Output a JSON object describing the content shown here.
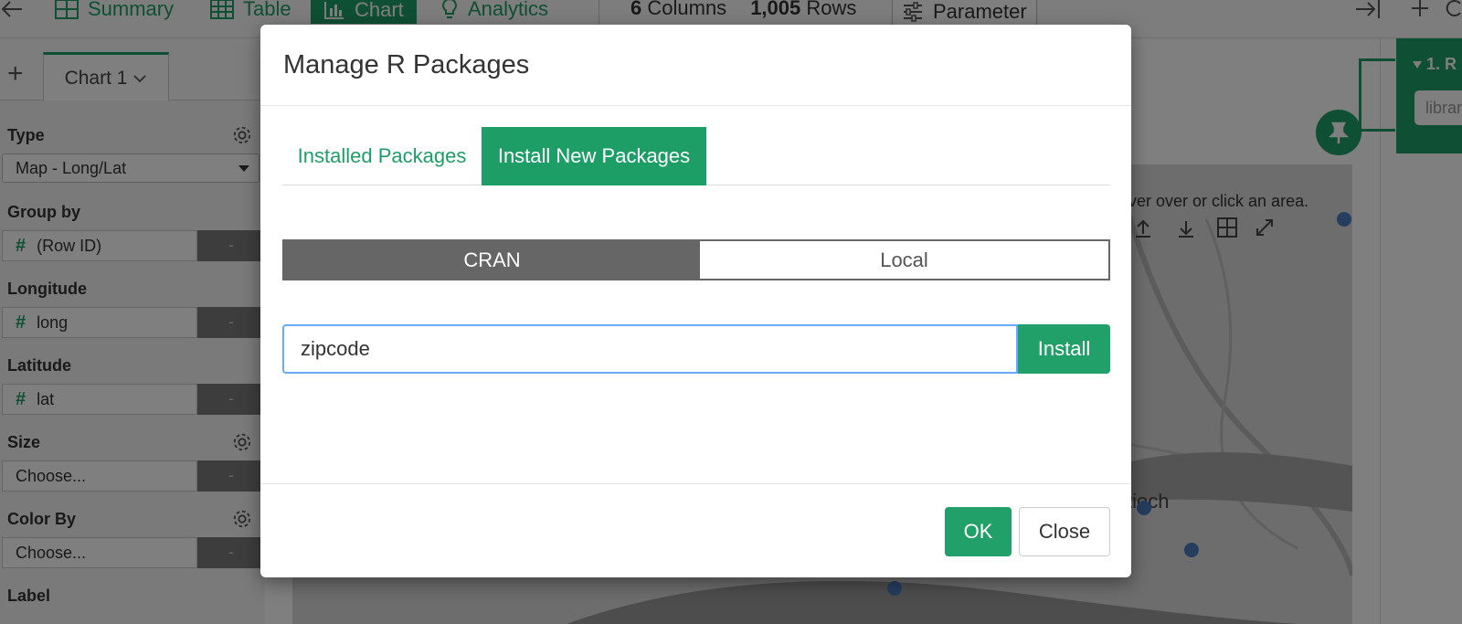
{
  "topbar": {
    "nav": [
      {
        "label": "Summary",
        "icon": "summary-grid-icon"
      },
      {
        "label": "Table",
        "icon": "table-icon"
      },
      {
        "label": "Chart",
        "icon": "bar-chart-icon",
        "active": true
      },
      {
        "label": "Analytics",
        "icon": "lightbulb-icon"
      }
    ],
    "columns_count": "6",
    "columns_label": "Columns",
    "rows_count": "1,005",
    "rows_label": "Rows",
    "parameter_label": "Parameter"
  },
  "chart_tabs": {
    "add_label": "+",
    "current": "Chart 1"
  },
  "config": {
    "type_label": "Type",
    "type_value": "Map - Long/Lat",
    "group_by_label": "Group by",
    "group_by_value": "(Row ID)",
    "longitude_label": "Longitude",
    "longitude_value": "long",
    "latitude_label": "Latitude",
    "latitude_value": "lat",
    "size_label": "Size",
    "size_value": "Choose...",
    "color_by_label": "Color By",
    "color_by_value": "Choose...",
    "label_label": "Label",
    "dash": "-"
  },
  "map": {
    "hint": "over over or click an area.",
    "place_label": "tioch"
  },
  "steps": {
    "first_title": "1. R",
    "first_input": "librar"
  },
  "modal": {
    "title": "Manage R Packages",
    "tabs": {
      "installed": "Installed Packages",
      "install_new": "Install New Packages"
    },
    "source": {
      "cran": "CRAN",
      "local": "Local"
    },
    "package_input_value": "zipcode",
    "install_label": "Install",
    "ok_label": "OK",
    "close_label": "Close"
  },
  "colors": {
    "accent": "#1e9e67",
    "focus": "#66a9ff",
    "segment_active": "#666666"
  }
}
